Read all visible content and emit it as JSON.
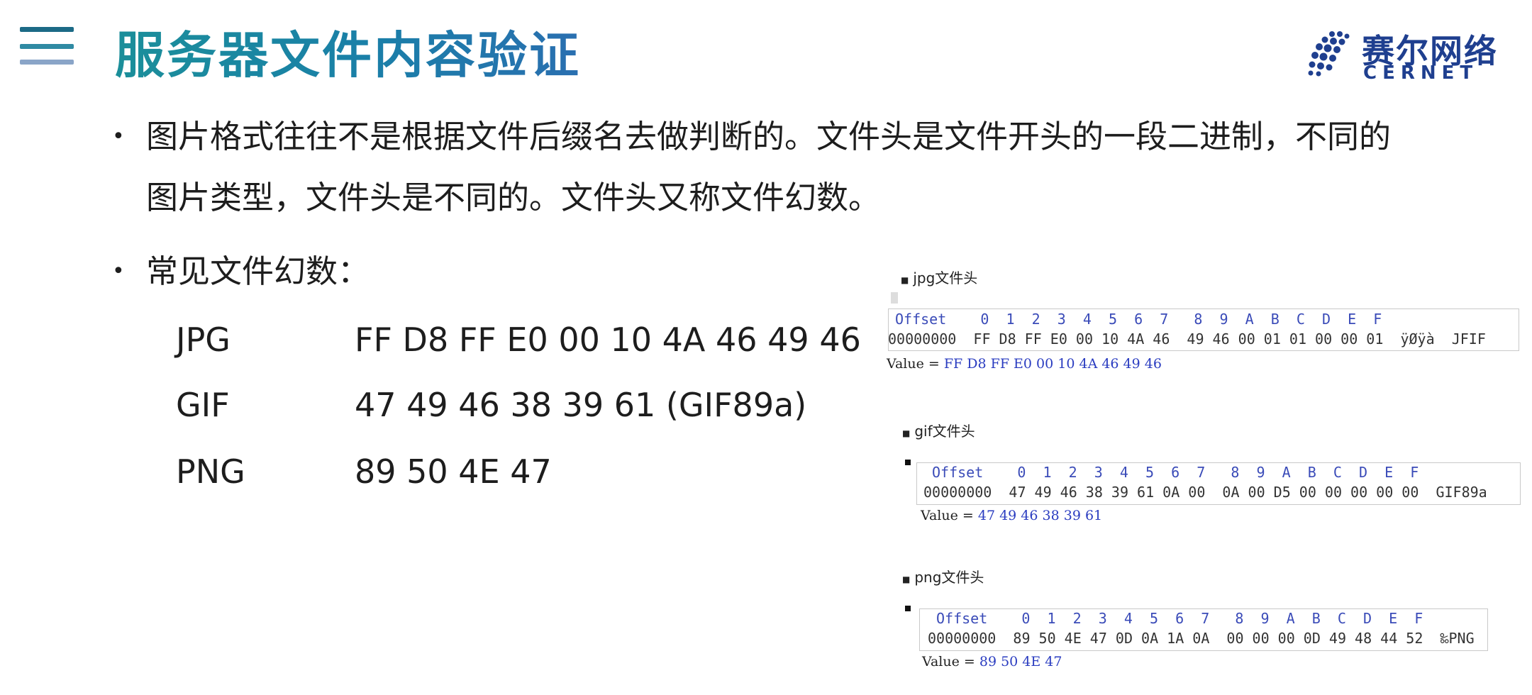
{
  "header": {
    "title": "服务器文件内容验证",
    "logo_cn": "赛尔网络",
    "logo_en": "CERNET"
  },
  "bullets": [
    {
      "text": "图片格式往往不是根据文件后缀名去做判断的。文件头是文件开头的一段二进制，不同的",
      "text2": "图片类型，文件头是不同的。文件头又称文件幻数。"
    },
    {
      "text": "常见文件幻数："
    }
  ],
  "magic_numbers": [
    {
      "format": "JPG",
      "hex": "FF D8 FF E0 00 10 4A 46 49 46"
    },
    {
      "format": "GIF",
      "hex": "47 49 46 38 39 61 (GIF89a)"
    },
    {
      "format": "PNG",
      "hex": "89 50 4E 47"
    }
  ],
  "hex_panels": [
    {
      "label": "jpg文件头",
      "header": "Offset    0  1  2  3  4  5  6  7   8  9  A  B  C  D  E  F",
      "row": "00000000  FF D8 FF E0 00 10 4A 46  49 46 00 01 01 00 00 01  ÿØÿà  JFIF",
      "value_label": "Value = ",
      "value": "FF D8 FF E0 00 10 4A 46 49 46"
    },
    {
      "label": "gif文件头",
      "header": "Offset    0  1  2  3  4  5  6  7   8  9  A  B  C  D  E  F",
      "row": "00000000  47 49 46 38 39 61 0A 00  0A 00 D5 00 00 00 00 00  GIF89a",
      "value_label": "Value = ",
      "value": "47 49 46 38 39 61"
    },
    {
      "label": "png文件头",
      "header": "Offset    0  1  2  3  4  5  6  7   8  9  A  B  C  D  E  F",
      "row": "00000000  89 50 4E 47 0D 0A 1A 0A  00 00 00 0D 49 48 44 52  ‰PNG",
      "value_label": "Value = ",
      "value": "89 50 4E 47"
    }
  ],
  "colors": {
    "title_start": "#1b8f9a",
    "title_end": "#2a6fb0",
    "logo": "#1f3f8f",
    "hex_header": "#3a4bb8",
    "value_link": "#2a3cc0"
  }
}
